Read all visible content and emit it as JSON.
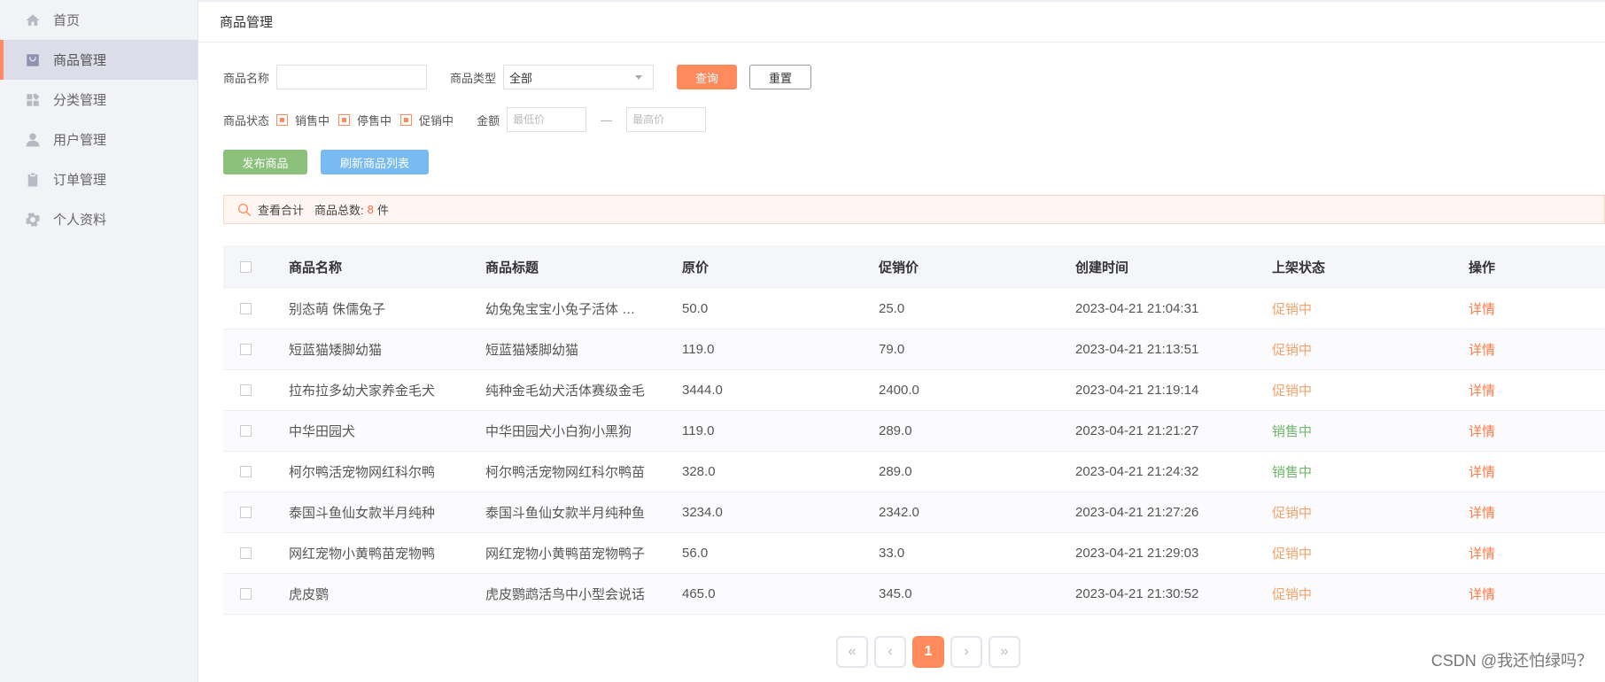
{
  "sidebar": {
    "items": [
      {
        "label": "首页",
        "icon": "home-icon",
        "active": false
      },
      {
        "label": "商品管理",
        "icon": "bag-icon",
        "active": true
      },
      {
        "label": "分类管理",
        "icon": "category-icon",
        "active": false
      },
      {
        "label": "用户管理",
        "icon": "user-icon",
        "active": false
      },
      {
        "label": "订单管理",
        "icon": "clipboard-icon",
        "active": false
      },
      {
        "label": "个人资料",
        "icon": "gear-icon",
        "active": false
      }
    ]
  },
  "header": {
    "title": "商品管理"
  },
  "filters": {
    "name_label": "商品名称",
    "name_value": "",
    "type_label": "商品类型",
    "type_value": "全部",
    "query_label": "查询",
    "reset_label": "重置",
    "status_label": "商品状态",
    "status_options": [
      "销售中",
      "停售中",
      "促销中"
    ],
    "price_label": "金额",
    "min_placeholder": "最低价",
    "dash": "—",
    "max_placeholder": "最高价",
    "publish_label": "发布商品",
    "refresh_label": "刷新商品列表"
  },
  "summary": {
    "view_total": "查看合计",
    "total_label": "商品总数:",
    "total_count": "8",
    "unit": "件"
  },
  "table": {
    "headers": [
      "商品名称",
      "商品标题",
      "原价",
      "促销价",
      "创建时间",
      "上架状态",
      "操作"
    ],
    "rows": [
      {
        "name": "别态萌 侏儒兔子",
        "title": "幼兔兔宝宝小兔子活体 宠物",
        "price": "50.0",
        "promo": "25.0",
        "created": "2023-04-21 21:04:31",
        "status": "促销中",
        "status_type": "promo",
        "action": "详情"
      },
      {
        "name": "短蓝猫矮脚幼猫",
        "title": "短蓝猫矮脚幼猫",
        "price": "119.0",
        "promo": "79.0",
        "created": "2023-04-21 21:13:51",
        "status": "促销中",
        "status_type": "promo",
        "action": "详情"
      },
      {
        "name": "拉布拉多幼犬家养金毛犬",
        "title": "纯种金毛幼犬活体赛级金毛",
        "price": "3444.0",
        "promo": "2400.0",
        "created": "2023-04-21 21:19:14",
        "status": "促销中",
        "status_type": "promo",
        "action": "详情"
      },
      {
        "name": "中华田园犬",
        "title": "中华田园犬小白狗小黑狗",
        "price": "119.0",
        "promo": "289.0",
        "created": "2023-04-21 21:21:27",
        "status": "销售中",
        "status_type": "sale",
        "action": "详情"
      },
      {
        "name": "柯尔鸭活宠物网红科尔鸭",
        "title": "柯尔鸭活宠物网红科尔鸭苗",
        "price": "328.0",
        "promo": "289.0",
        "created": "2023-04-21 21:24:32",
        "status": "销售中",
        "status_type": "sale",
        "action": "详情"
      },
      {
        "name": "泰国斗鱼仙女款半月纯种",
        "title": "泰国斗鱼仙女款半月纯种鱼",
        "price": "3234.0",
        "promo": "2342.0",
        "created": "2023-04-21 21:27:26",
        "status": "促销中",
        "status_type": "promo",
        "action": "详情"
      },
      {
        "name": "网红宠物小黄鸭苗宠物鸭",
        "title": "网红宠物小黄鸭苗宠物鸭子",
        "price": "56.0",
        "promo": "33.0",
        "created": "2023-04-21 21:29:03",
        "status": "促销中",
        "status_type": "promo",
        "action": "详情"
      },
      {
        "name": "虎皮鹦",
        "title": "虎皮鹦鹉活鸟中小型会说话",
        "price": "465.0",
        "promo": "345.0",
        "created": "2023-04-21 21:30:52",
        "status": "促销中",
        "status_type": "promo",
        "action": "详情"
      }
    ]
  },
  "pagination": {
    "first": "«",
    "prev": "‹",
    "current": "1",
    "next": "›",
    "last": "»"
  },
  "watermark": "CSDN @我还怕绿吗？",
  "colors": {
    "accent": "#ff8a5c",
    "promo": "#f3a36a",
    "sale": "#6fb86b",
    "publish": "#8bc17a",
    "refresh": "#78bbf2"
  }
}
